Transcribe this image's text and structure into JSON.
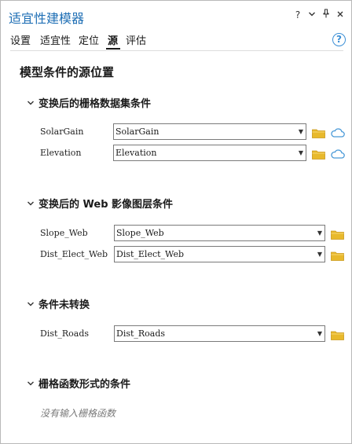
{
  "window": {
    "title": "适宜性建模器",
    "controls": {
      "help": "?",
      "menu": "⌄",
      "pin": "⊥",
      "close": "✕"
    }
  },
  "tabs": [
    {
      "label": "设置",
      "active": false
    },
    {
      "label": "适宜性",
      "active": false
    },
    {
      "label": "定位",
      "active": false
    },
    {
      "label": "源",
      "active": true
    },
    {
      "label": "评估",
      "active": false
    }
  ],
  "help_button": {
    "label": "?"
  },
  "page_title": "模型条件的源位置",
  "sections": [
    {
      "title": "变换后的栅格数据集条件",
      "rows": [
        {
          "label": "SolarGain",
          "value": "SolarGain",
          "folder_icon": "folder-icon",
          "cloud_icon": "cloud-icon"
        },
        {
          "label": "Elevation",
          "value": "Elevation",
          "folder_icon": "folder-icon",
          "cloud_icon": "cloud-icon"
        }
      ]
    },
    {
      "title": "变换后的 Web 影像图层条件",
      "rows": [
        {
          "label": "Slope_Web",
          "value": "Slope_Web",
          "folder_icon": "folder-icon"
        },
        {
          "label": "Dist_Elect_Web",
          "value": "Dist_Elect_Web",
          "folder_icon": "folder-icon"
        }
      ]
    },
    {
      "title": "条件未转换",
      "rows": [
        {
          "label": "Dist_Roads",
          "value": "Dist_Roads",
          "folder_icon": "folder-icon"
        }
      ]
    },
    {
      "title": "栅格函数形式的条件",
      "empty_note": "没有输入栅格函数"
    }
  ],
  "colors": {
    "title_blue": "#1f6fb5",
    "help_blue": "#3b8fd6",
    "folder_yellow": "#e8b92c",
    "cloud_blue": "#4a9ad8"
  }
}
